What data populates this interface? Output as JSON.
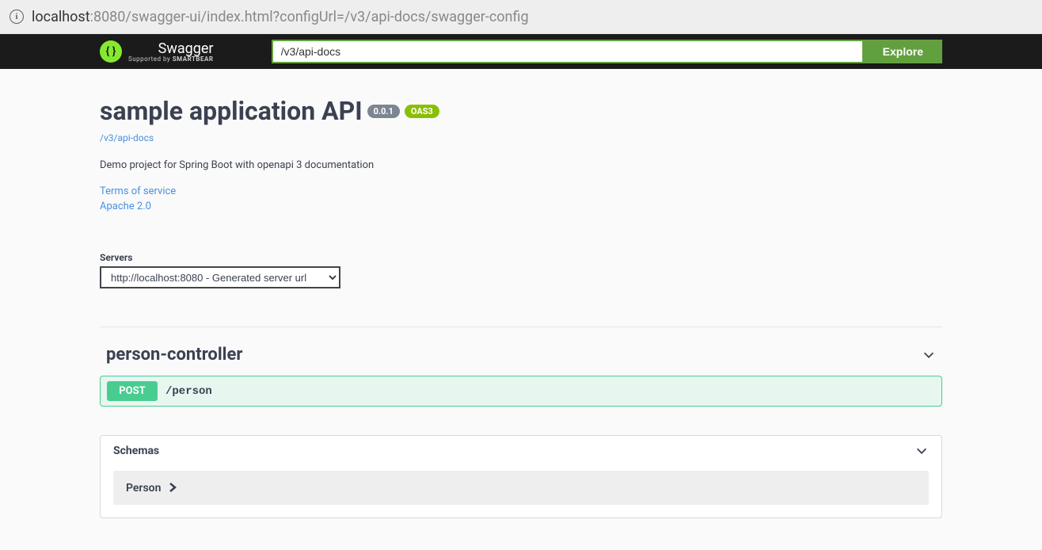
{
  "address_bar": {
    "host": "localhost",
    "port_path": ":8080/swagger-ui/index.html?configUrl=/v3/api-docs/swagger-config"
  },
  "topbar": {
    "brand": "Swagger",
    "subbrand_prefix": "Supported by ",
    "subbrand_bold": "SMARTBEAR",
    "search_value": "/v3/api-docs",
    "explore_label": "Explore"
  },
  "info": {
    "title": "sample application API",
    "version": "0.0.1",
    "oas_badge": "OAS3",
    "docs_url_label": "/v3/api-docs",
    "description": "Demo project for Spring Boot with openapi 3 documentation",
    "terms_label": "Terms of service",
    "license_label": "Apache 2.0"
  },
  "servers": {
    "label": "Servers",
    "selected": "http://localhost:8080 - Generated server url"
  },
  "tag": {
    "name": "person-controller"
  },
  "operations": [
    {
      "method": "POST",
      "path": "/person"
    }
  ],
  "schemas": {
    "title": "Schemas",
    "items": [
      "Person"
    ]
  }
}
